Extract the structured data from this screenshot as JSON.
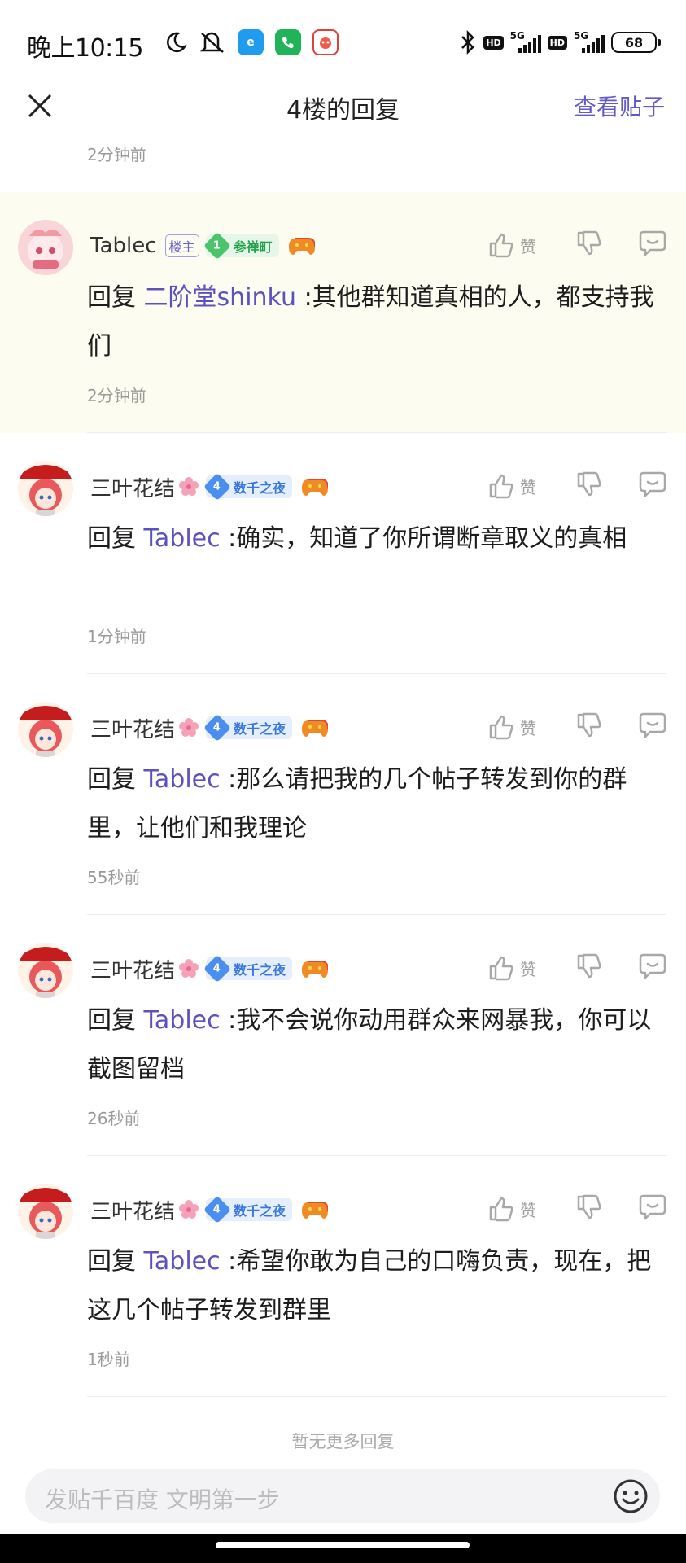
{
  "status_bar": {
    "time": "晚上10:15",
    "network_5g_a": "5G",
    "network_5g_b": "5G",
    "hd_a": "HD",
    "hd_b": "HD",
    "battery": "68"
  },
  "title_bar": {
    "title": "4楼的回复",
    "view_post_label": "查看贴子"
  },
  "prev_reply_time": "2分钟前",
  "action_labels": {
    "like": "赞"
  },
  "reply_prefix": "回复",
  "replies": [
    {
      "user": "Tablec",
      "owner_tag": "楼主",
      "level": "1",
      "badge": "参禅町",
      "badge_color": "green",
      "mention": "二阶堂shinku",
      "text": ":其他群知道真相的人，都支持我们",
      "time": "2分钟前"
    },
    {
      "user": "三叶花结",
      "level": "4",
      "badge": "数千之夜",
      "badge_color": "blue",
      "mention": "Tablec",
      "text": ":确实，知道了你所谓断章取义的真相",
      "time": "1分钟前"
    },
    {
      "user": "三叶花结",
      "level": "4",
      "badge": "数千之夜",
      "badge_color": "blue",
      "mention": "Tablec",
      "text": ":那么请把我的几个帖子转发到你的群里，让他们和我理论",
      "time": "55秒前"
    },
    {
      "user": "三叶花结",
      "level": "4",
      "badge": "数千之夜",
      "badge_color": "blue",
      "mention": "Tablec",
      "text": ":我不会说你动用群众来网暴我，你可以截图留档",
      "time": "26秒前"
    },
    {
      "user": "三叶花结",
      "level": "4",
      "badge": "数千之夜",
      "badge_color": "blue",
      "mention": "Tablec",
      "text": ":希望你敢为自己的口嗨负责，现在，把这几个帖子转发到群里",
      "time": "1秒前"
    }
  ],
  "no_more_text": "暂无更多回复",
  "input": {
    "placeholder": "发贴千百度 文明第一步"
  },
  "colors": {
    "accent": "#6359c8",
    "highlight_bg": "#fdfcf0"
  }
}
